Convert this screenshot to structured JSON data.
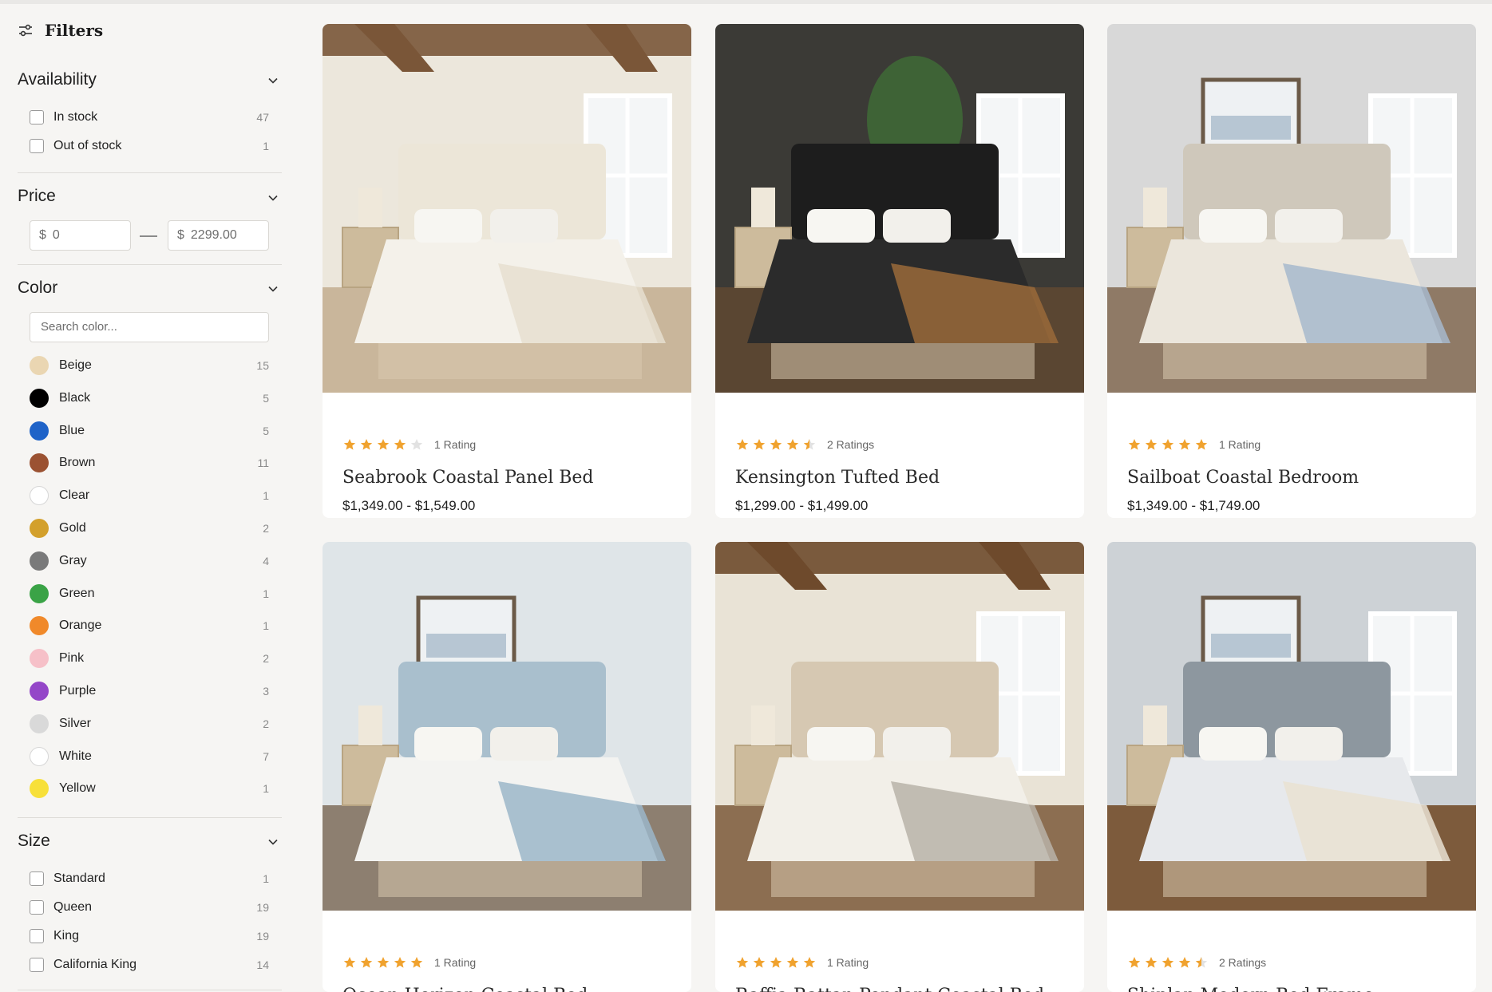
{
  "filters": {
    "title": "Filters",
    "availability": {
      "title": "Availability",
      "options": [
        {
          "label": "In stock",
          "count": "47"
        },
        {
          "label": "Out of stock",
          "count": "1"
        }
      ]
    },
    "price": {
      "title": "Price",
      "currency": "$",
      "min_value": "0",
      "max_placeholder": "2299.00"
    },
    "color": {
      "title": "Color",
      "search_placeholder": "Search color...",
      "options": [
        {
          "label": "Beige",
          "count": "15",
          "hex": "#ead6b2"
        },
        {
          "label": "Black",
          "count": "5",
          "hex": "#000000"
        },
        {
          "label": "Blue",
          "count": "5",
          "hex": "#1f63c8"
        },
        {
          "label": "Brown",
          "count": "11",
          "hex": "#9b5232"
        },
        {
          "label": "Clear",
          "count": "1",
          "hex": "#ffffff"
        },
        {
          "label": "Gold",
          "count": "2",
          "hex": "#d3a02c"
        },
        {
          "label": "Gray",
          "count": "4",
          "hex": "#7a7a7a"
        },
        {
          "label": "Green",
          "count": "1",
          "hex": "#3aa346"
        },
        {
          "label": "Orange",
          "count": "1",
          "hex": "#f0892a"
        },
        {
          "label": "Pink",
          "count": "2",
          "hex": "#f6c0c8"
        },
        {
          "label": "Purple",
          "count": "3",
          "hex": "#9446c8"
        },
        {
          "label": "Silver",
          "count": "2",
          "hex": "#d9d9d9"
        },
        {
          "label": "White",
          "count": "7",
          "hex": "#ffffff"
        },
        {
          "label": "Yellow",
          "count": "1",
          "hex": "#f7e03a"
        }
      ]
    },
    "size": {
      "title": "Size",
      "options": [
        {
          "label": "Standard",
          "count": "1"
        },
        {
          "label": "Queen",
          "count": "19"
        },
        {
          "label": "King",
          "count": "19"
        },
        {
          "label": "California King",
          "count": "14"
        }
      ]
    }
  },
  "products": [
    {
      "title": "Seabrook Coastal Panel Bed",
      "price": "$1,349.00 - $1,549.00",
      "rating": 4,
      "rating_text": "1 Rating"
    },
    {
      "title": "Kensington Tufted Bed",
      "price": "$1,299.00 - $1,499.00",
      "rating": 4.5,
      "rating_text": "2 Ratings"
    },
    {
      "title": "Sailboat Coastal Bedroom",
      "price": "$1,349.00 - $1,749.00",
      "rating": 5,
      "rating_text": "1 Rating"
    },
    {
      "title": "Ocean Horizon Coastal Bed",
      "price": "",
      "rating": 5,
      "rating_text": "1 Rating"
    },
    {
      "title": "Raffia Rattan Pendant Coastal Bed",
      "price": "",
      "rating": 5,
      "rating_text": "1 Rating"
    },
    {
      "title": "Shiplap Modern Bed Frame",
      "price": "",
      "rating": 4.5,
      "rating_text": "2 Ratings"
    }
  ],
  "colors": {
    "star": "#f0a22e",
    "star_empty": "#e2e2e2",
    "page_bg": "#f6f5f3"
  }
}
